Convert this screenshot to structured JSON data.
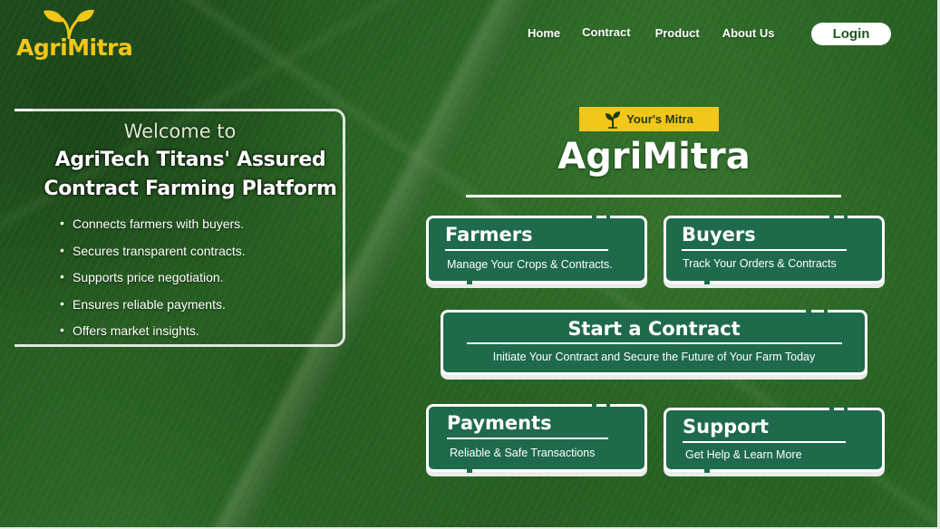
{
  "brand": {
    "logo_text": "AgriMitra",
    "logo_color": "#f3c61a"
  },
  "nav": {
    "items": [
      "Home",
      "Contract",
      "Product",
      "About Us"
    ],
    "login_label": "Login"
  },
  "welcome": {
    "subtitle": "Welcome to",
    "title_line1": "AgriTech Titans' Assured",
    "title_line2": "Contract Farming Platform",
    "features": [
      "Connects farmers with buyers.",
      "Secures transparent contracts.",
      "Supports price negotiation.",
      "Ensures reliable payments.",
      "Offers market insights."
    ]
  },
  "hero": {
    "tag_label": "Your's Mitra",
    "tag_icon": "sprout-icon",
    "title": "AgriMitra",
    "accent_color": "#f3c61a",
    "card_color": "#1f6a4b"
  },
  "cards": {
    "farmers": {
      "title": "Farmers",
      "desc": "Manage Your Crops & Contracts."
    },
    "buyers": {
      "title": "Buyers",
      "desc": "Track Your Orders & Contracts"
    },
    "contract": {
      "title": "Start a Contract",
      "desc": "Initiate Your Contract and Secure the Future of Your Farm Today"
    },
    "payments": {
      "title": "Payments",
      "desc": "Reliable & Safe Transactions"
    },
    "support": {
      "title": "Support",
      "desc": "Get Help & Learn More"
    }
  }
}
